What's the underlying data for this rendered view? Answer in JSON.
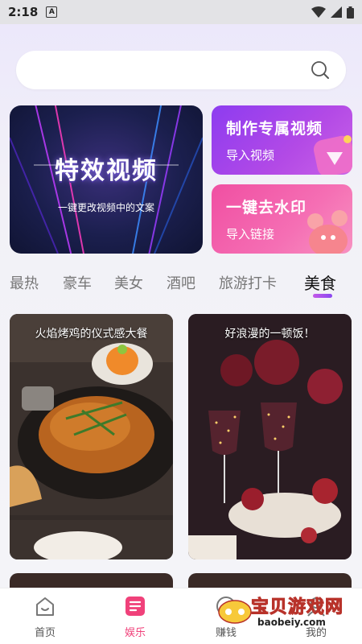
{
  "status_bar": {
    "time": "2:18",
    "notif_letter": "A"
  },
  "search": {
    "placeholder": ""
  },
  "banners": {
    "effects": {
      "title": "特效视频",
      "subtitle": "一键更改视频中的文案"
    },
    "custom_video": {
      "title": "制作专属视频",
      "subtitle": "导入视频"
    },
    "remove_watermark": {
      "title": "一键去水印",
      "subtitle": "导入链接"
    }
  },
  "tabs": [
    "最热",
    "豪车",
    "美女",
    "酒吧",
    "旅游打卡",
    "美食"
  ],
  "active_tab": "美食",
  "cards": [
    {
      "caption": "火焰烤鸡的仪式感大餐"
    },
    {
      "caption": "好浪漫的一顿饭！"
    }
  ],
  "bottom_nav": {
    "home": "首页",
    "entertainment": "娱乐",
    "earn": "赚钱",
    "mine": "我的"
  },
  "watermark": {
    "title": "宝贝游戏网",
    "url": "baobeiy.com"
  },
  "colors": {
    "accent": "#f0417a",
    "tab_indicator": "#a64fee"
  }
}
